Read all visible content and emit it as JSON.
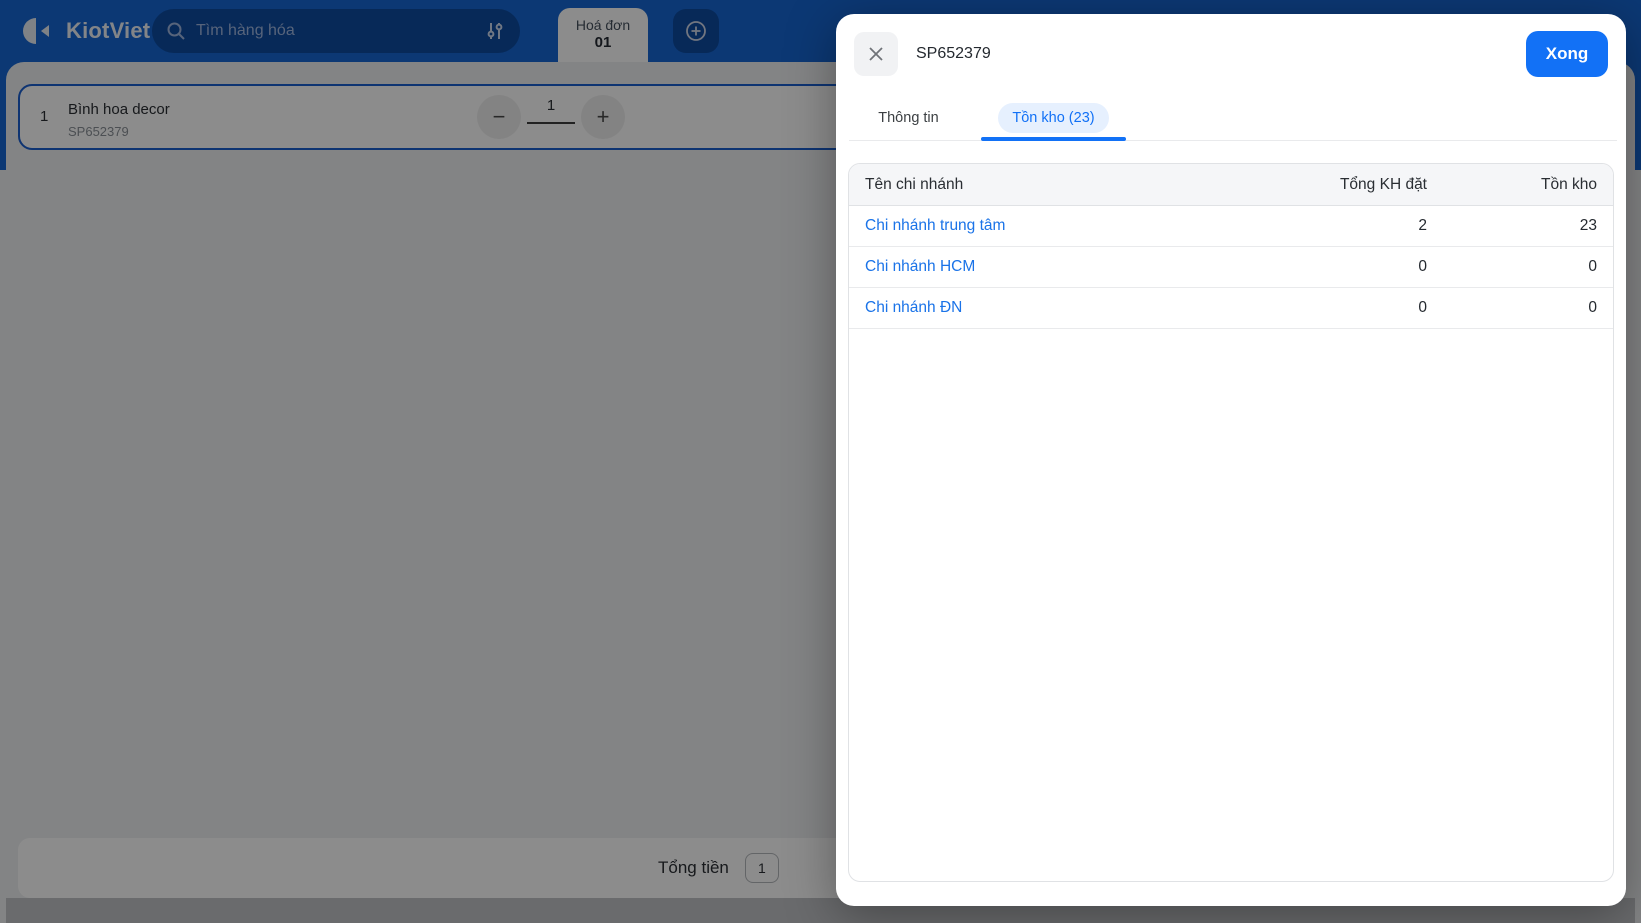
{
  "topbar": {
    "brand": "KiotViet",
    "search_placeholder": "Tìm hàng hóa",
    "invoice_tab_label": "Hoá đơn",
    "invoice_tab_number": "01"
  },
  "cart": {
    "row": {
      "index": "1",
      "name": "Bình hoa decor",
      "sku": "SP652379",
      "quantity": "1",
      "minus_label": "−",
      "plus_label": "+"
    },
    "footer": {
      "total_label": "Tổng tiền",
      "total_qty_badge": "1"
    }
  },
  "modal": {
    "title": "SP652379",
    "done_label": "Xong",
    "tabs": [
      {
        "label": "Thông tin",
        "active": false
      },
      {
        "label": "Tồn kho (23)",
        "active": true
      }
    ],
    "table": {
      "headers": [
        "Tên chi nhánh",
        "Tổng KH đặt",
        "Tồn kho"
      ],
      "rows": [
        {
          "name": "Chi nhánh trung tâm",
          "kh_dat": "2",
          "ton_kho": "23"
        },
        {
          "name": "Chi nhánh HCM",
          "kh_dat": "0",
          "ton_kho": "0"
        },
        {
          "name": "Chi nhánh ĐN",
          "kh_dat": "0",
          "ton_kho": "0"
        }
      ]
    }
  },
  "colors": {
    "topbar_blue": "#1766d3",
    "topbar_inset_blue": "#0d4ba0",
    "accent_blue": "#1271f6",
    "link_blue": "#1a73e8",
    "tab_pill_bg": "#e6f0fe",
    "selected_card_border": "#1a5fd0",
    "page_bg": "#eef0f3"
  }
}
